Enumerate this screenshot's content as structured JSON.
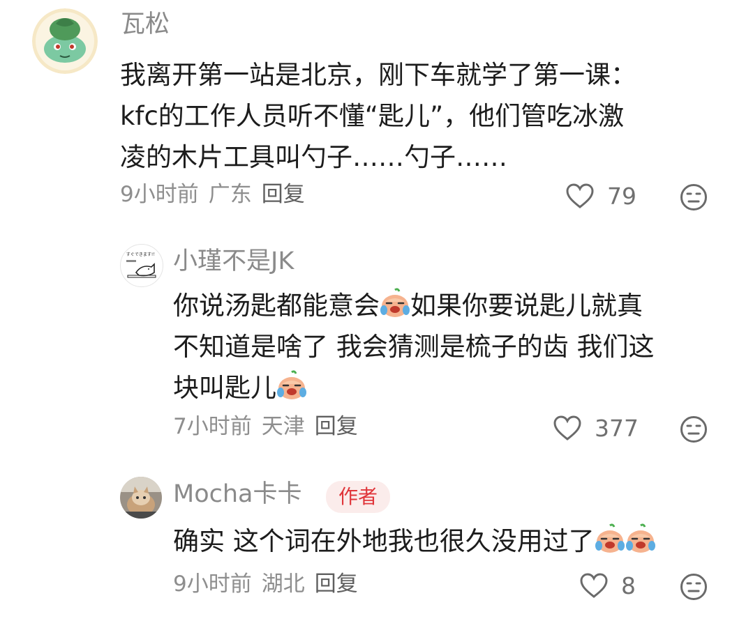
{
  "comments": [
    {
      "username": "瓦松",
      "avatar_icon": "bulbasaur-avatar-icon",
      "lines": [
        "我离开第一站是北京，刚下车就学了第一课：",
        "kfc的工作人员听不懂“匙儿”，他们管吃冰激",
        "凌的木片工具叫勺子……勺子……"
      ],
      "time": "9小时前",
      "location": "广东",
      "reply": "回复",
      "likes": "79"
    },
    {
      "username": "小瑾不是JK",
      "avatar_icon": "sketch-cat-avatar-icon",
      "avatar_text": "すぐできます!！",
      "lines": [
        "你说汤匙都能意会",
        "如果你要说匙儿就真",
        "不知道是啥了 我会猜测是梳子的齿 我们这",
        "块叫匙儿"
      ],
      "time": "7小时前",
      "location": "天津",
      "reply": "回复",
      "likes": "377"
    },
    {
      "username": "Mocha卡卡",
      "badge": "作者",
      "avatar_icon": "cat-photo-avatar-icon",
      "lines": [
        "确实 这个词在外地我也很久没用过了"
      ],
      "time": "9小时前",
      "location": "湖北",
      "reply": "回复",
      "likes": "8"
    }
  ],
  "colors": {
    "username": "#8a8a8a",
    "body": "#1c1c1c",
    "meta": "#8e8e8e",
    "badge_bg": "#fbeceb",
    "badge_text": "#e0353a"
  }
}
